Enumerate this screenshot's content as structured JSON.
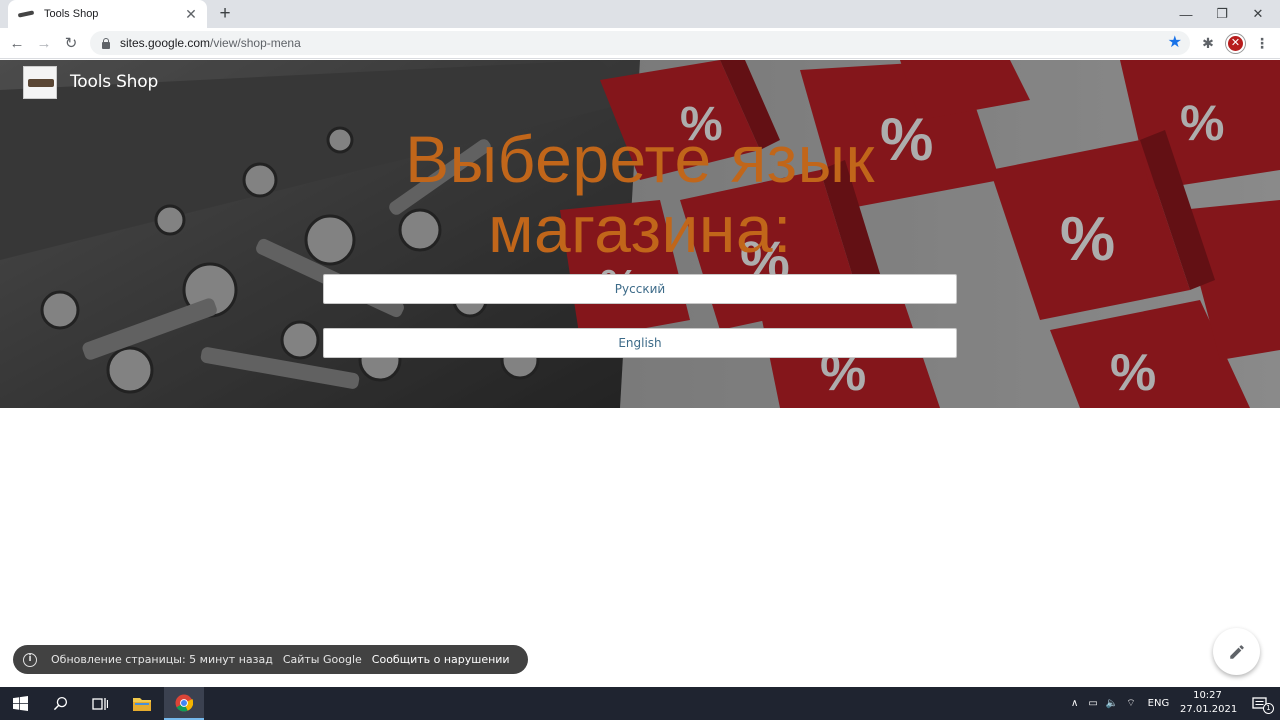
{
  "browser": {
    "tab": {
      "title": "Tools Shop",
      "close_glyph": "✕"
    },
    "new_tab_glyph": "+",
    "window_controls": {
      "minimize": "—",
      "restore": "❐",
      "close": "✕"
    },
    "nav": {
      "back": "←",
      "forward": "→",
      "reload": "↻"
    },
    "url_host": "sites.google.com",
    "url_path": "/view/shop-mena",
    "star_glyph": "★",
    "extensions_glyph": "✱",
    "menu_glyph": "⋮",
    "profile_glyph": "✕"
  },
  "site": {
    "title": "Tools Shop",
    "headline_line1": "Выберете язык",
    "headline_line2": "магазина:",
    "headline_color": "#c1661a",
    "buttons": [
      {
        "label": "Русский"
      },
      {
        "label": "English"
      }
    ]
  },
  "footer": {
    "info_glyph": "i",
    "updated": "Обновление страницы: 5 минут назад",
    "google_sites": "Сайты Google",
    "report": "Сообщить о нарушении"
  },
  "taskbar": {
    "language": "ENG",
    "time": "10:27",
    "date": "27.01.2021",
    "notification_count": "1"
  }
}
